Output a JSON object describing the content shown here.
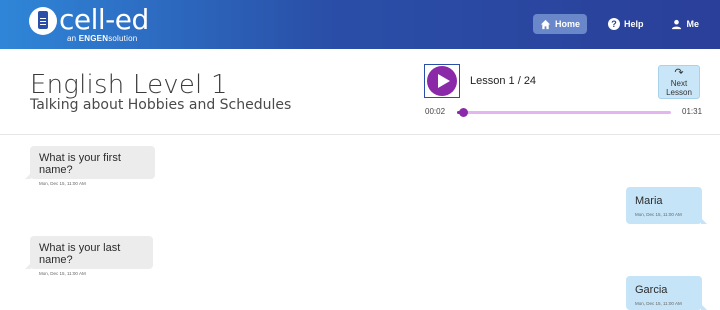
{
  "header": {
    "logo_name": "cell-ed",
    "logo_tag_prefix": "an",
    "logo_tag_brand": "ENGEN",
    "logo_tag_suffix": "solution",
    "nav": [
      {
        "label": "Home",
        "icon": "home-icon",
        "active": true
      },
      {
        "label": "Help",
        "icon": "help-icon",
        "active": false
      },
      {
        "label": "Me",
        "icon": "user-icon",
        "active": false
      }
    ]
  },
  "lesson": {
    "title": "English Level 1",
    "subtitle": "Talking about Hobbies and Schedules"
  },
  "player": {
    "lesson_count": "Lesson 1 / 24",
    "time_current": "00:02",
    "time_total": "01:31",
    "progress": 0.03,
    "next_label_line1": "Next",
    "next_label_line2": "Lesson"
  },
  "messages": [
    {
      "side": "left",
      "text": "What is your first name?",
      "timestamp": "Mon, Dec 15, 11:00 AM"
    },
    {
      "side": "right",
      "text": "Maria",
      "timestamp": "Mon, Dec 15, 11:00 AM"
    },
    {
      "side": "left",
      "text": "What is your last name?",
      "timestamp": "Mon, Dec 15, 11:00 AM"
    },
    {
      "side": "right",
      "text": "Garcia",
      "timestamp": "Mon, Dec 15, 11:00 AM"
    }
  ],
  "colors": {
    "header_start": "#2f86d8",
    "header_end": "#2a3f99",
    "accent_purple": "#8a2aa8",
    "bubble_left": "#ececec",
    "bubble_right": "#c5e4f7"
  }
}
